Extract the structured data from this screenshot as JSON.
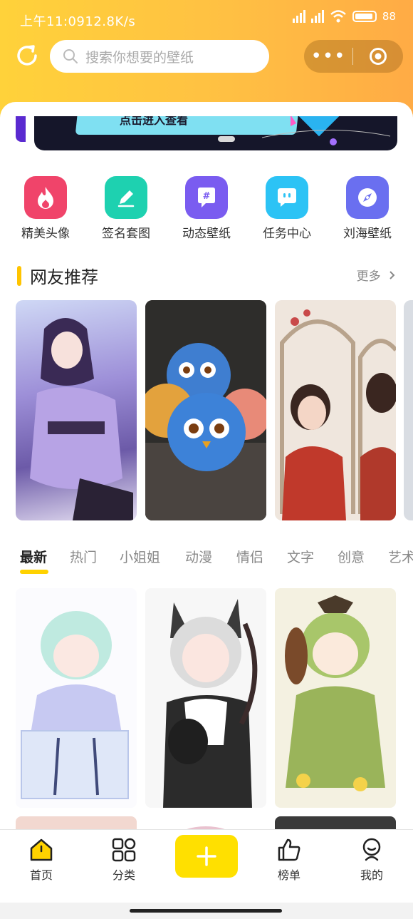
{
  "status": {
    "time": "上午11:09",
    "speed": "12.8K/s",
    "battery": "88"
  },
  "search": {
    "placeholder": "搜索你想要的壁纸"
  },
  "banner": {
    "text": "点击进入查看"
  },
  "shortcuts": [
    {
      "label": "精美头像",
      "icon": "flame-icon",
      "color": "#f0446a"
    },
    {
      "label": "签名套图",
      "icon": "pencil-icon",
      "color": "#1ed1b0"
    },
    {
      "label": "动态壁纸",
      "icon": "hashtag-icon",
      "color": "#7a5cf0"
    },
    {
      "label": "任务中心",
      "icon": "chat-bubble-icon",
      "color": "#2cc3f5"
    },
    {
      "label": "刘海壁纸",
      "icon": "compass-icon",
      "color": "#6a6ff0"
    }
  ],
  "recommend": {
    "title": "网友推荐",
    "more": "更多"
  },
  "tabs": [
    "最新",
    "热门",
    "小姐姐",
    "动漫",
    "情侣",
    "文字",
    "创意",
    "艺术"
  ],
  "nav": {
    "home": "首页",
    "category": "分类",
    "ranking": "榜单",
    "mine": "我的"
  },
  "colors": {
    "accent": "#ffd200",
    "header_gradient_start": "#ffd23a",
    "header_gradient_end": "#ffab45"
  }
}
